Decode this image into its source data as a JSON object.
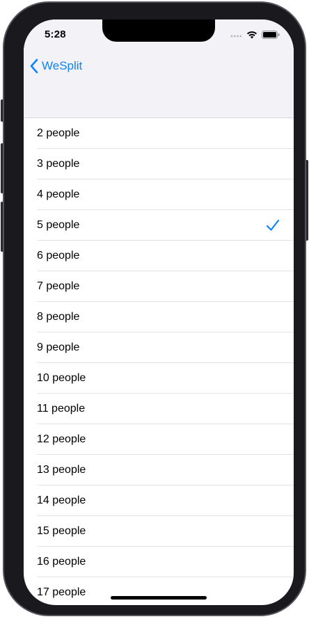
{
  "status_bar": {
    "time": "5:28"
  },
  "nav": {
    "back_label": "WeSplit"
  },
  "list": {
    "rows": [
      {
        "label": "2 people",
        "selected": false
      },
      {
        "label": "3 people",
        "selected": false
      },
      {
        "label": "4 people",
        "selected": false
      },
      {
        "label": "5 people",
        "selected": true
      },
      {
        "label": "6 people",
        "selected": false
      },
      {
        "label": "7 people",
        "selected": false
      },
      {
        "label": "8 people",
        "selected": false
      },
      {
        "label": "9 people",
        "selected": false
      },
      {
        "label": "10 people",
        "selected": false
      },
      {
        "label": "11 people",
        "selected": false
      },
      {
        "label": "12 people",
        "selected": false
      },
      {
        "label": "13 people",
        "selected": false
      },
      {
        "label": "14 people",
        "selected": false
      },
      {
        "label": "15 people",
        "selected": false
      },
      {
        "label": "16 people",
        "selected": false
      },
      {
        "label": "17 people",
        "selected": false
      }
    ]
  },
  "colors": {
    "accent": "#0a84ff",
    "nav_background": "#f2f2f7",
    "separator": "#e3e3e6"
  },
  "icons": {
    "back": "chevron-left-icon",
    "selected": "checkmark-icon",
    "signal": "cellular-signal-icon",
    "wifi": "wifi-icon",
    "battery": "battery-icon"
  }
}
